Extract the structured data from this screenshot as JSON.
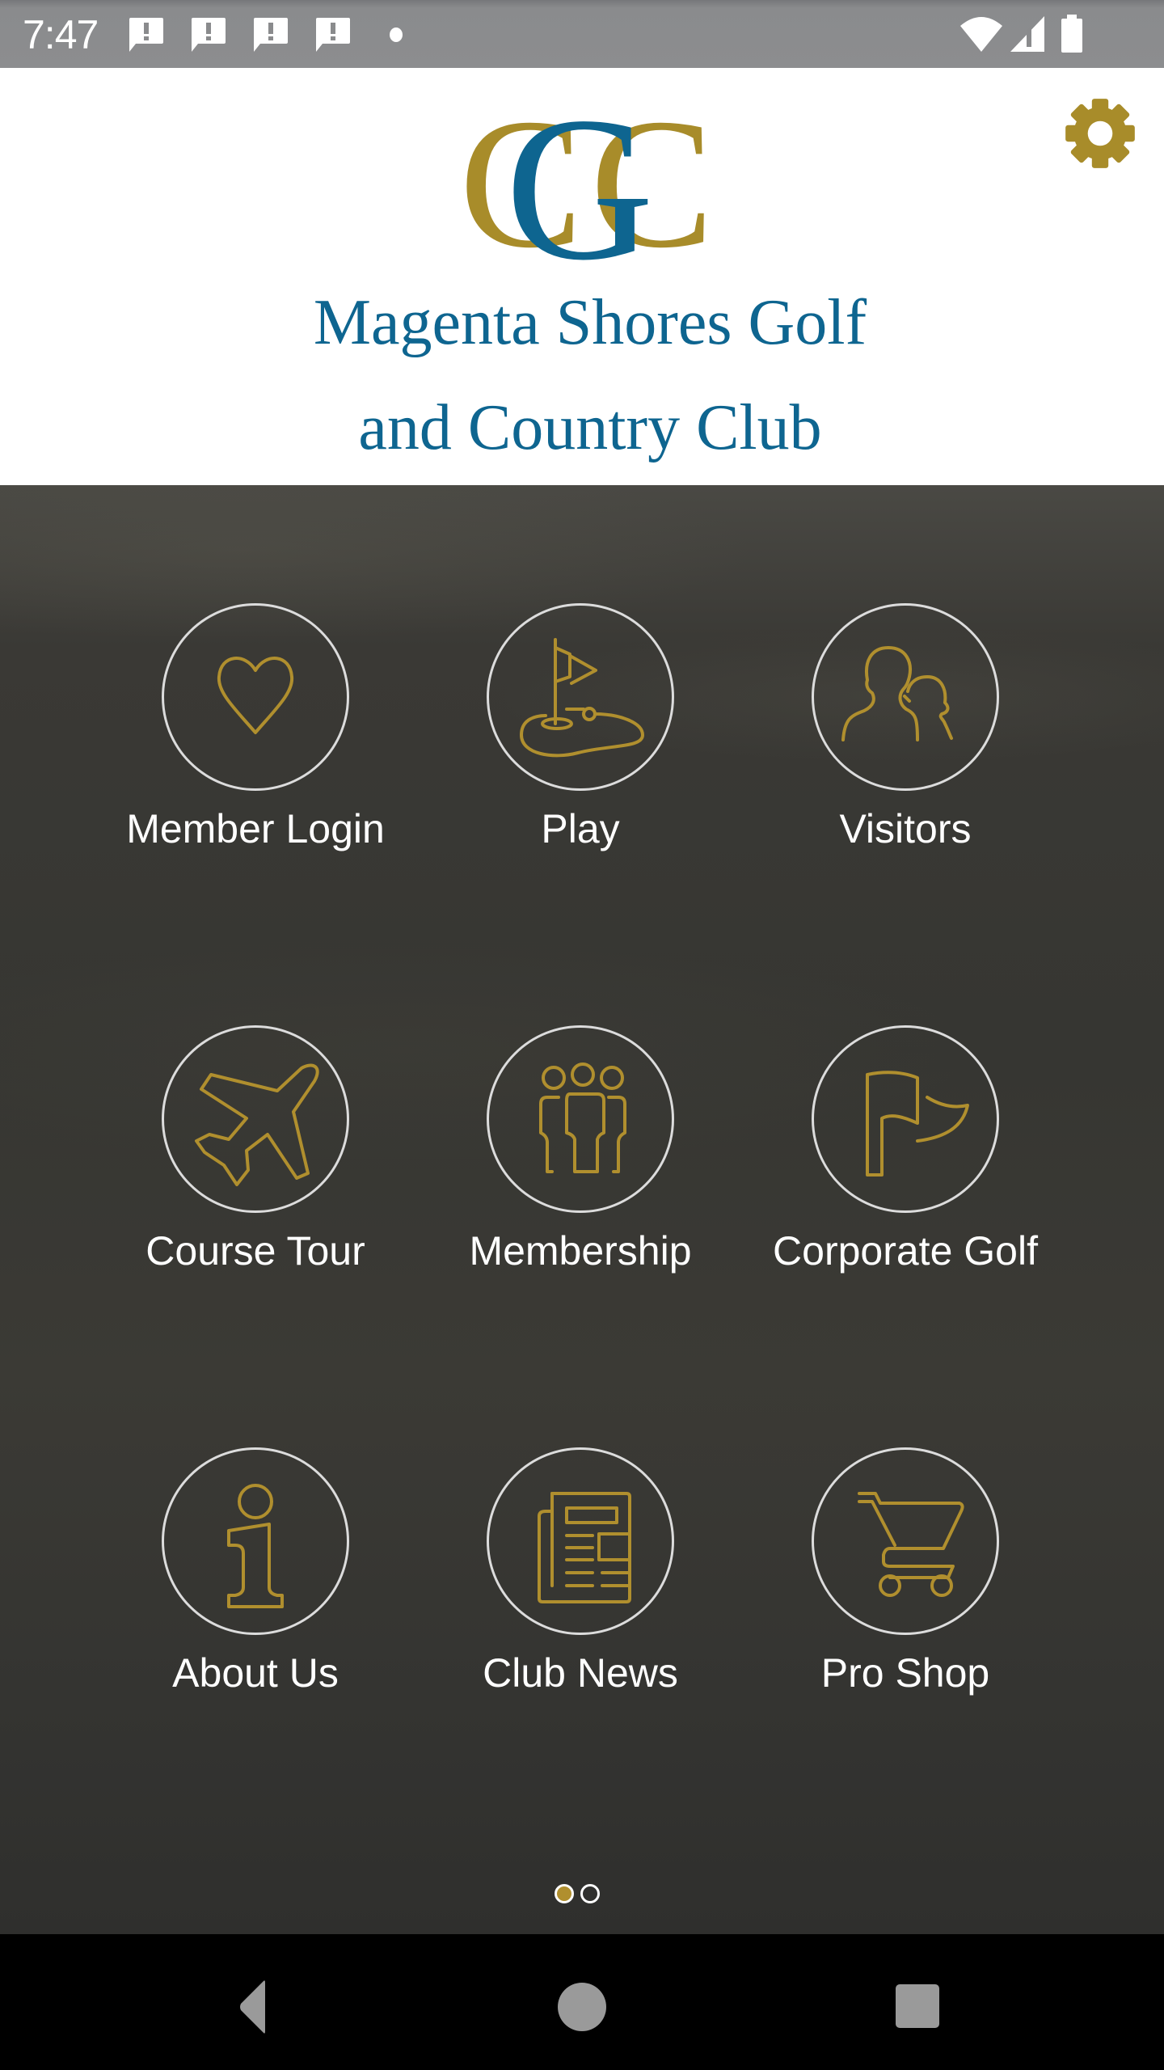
{
  "status_bar": {
    "time": "7:47",
    "notifications": [
      "alert-message-icon",
      "alert-message-icon",
      "alert-message-icon",
      "alert-message-icon"
    ],
    "more_indicator": "dot-icon",
    "system_icons": [
      "wifi-icon",
      "cellular-signal-icon",
      "battery-icon"
    ]
  },
  "header": {
    "logo_monogram": "CGC",
    "logo_line_1": "Magenta Shores Golf",
    "logo_line_2": "and Country Club",
    "settings_icon": "gear-icon"
  },
  "colors": {
    "brand_gold": "#a88c2a",
    "brand_blue": "#0e6590",
    "icon_gold": "#b08f2e",
    "circle_border": "#dcdcdc"
  },
  "menu": {
    "items": [
      {
        "label": "Member Login",
        "icon": "heart-icon"
      },
      {
        "label": "Play",
        "icon": "golf-flag-green-icon"
      },
      {
        "label": "Visitors",
        "icon": "people-icon"
      },
      {
        "label": "Course Tour",
        "icon": "airplane-icon"
      },
      {
        "label": "Membership",
        "icon": "group-icon"
      },
      {
        "label": "Corporate Golf",
        "icon": "flag-icon"
      },
      {
        "label": "About Us",
        "icon": "info-icon"
      },
      {
        "label": "Club News",
        "icon": "newspaper-icon"
      },
      {
        "label": "Pro Shop",
        "icon": "shopping-cart-icon"
      }
    ]
  },
  "pager": {
    "pages": 2,
    "current": 1
  },
  "nav_bar": {
    "buttons": [
      "back-icon",
      "home-icon",
      "recents-icon"
    ]
  }
}
